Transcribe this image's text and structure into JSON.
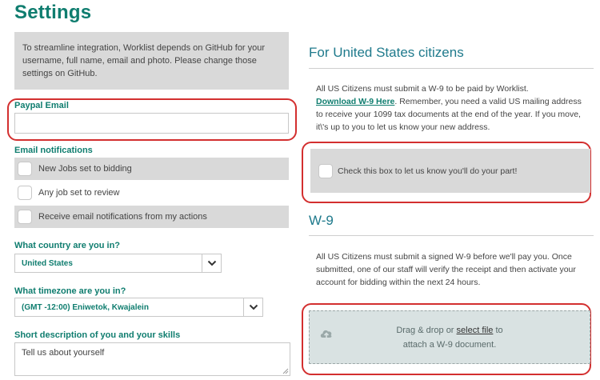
{
  "page": {
    "title": "Settings"
  },
  "info_box": {
    "text": "To streamline integration, Worklist depends on GitHub for your username, full name, email and photo. Please change those settings on GitHub."
  },
  "paypal": {
    "label": "Paypal Email",
    "value": ""
  },
  "email_notifications": {
    "heading": "Email notifications",
    "options": [
      {
        "label": "New Jobs set to bidding",
        "checked": false
      },
      {
        "label": "Any job set to review",
        "checked": false
      },
      {
        "label": "Receive email notifications from my actions",
        "checked": false
      }
    ]
  },
  "country": {
    "label": "What country are you in?",
    "selected": "United States"
  },
  "timezone": {
    "label": "What timezone are you in?",
    "selected": "(GMT -12:00) Eniwetok, Kwajalein"
  },
  "description": {
    "label": "Short description of you and your skills",
    "placeholder": "Tell us about yourself"
  },
  "us_citizens": {
    "title": "For United States citizens",
    "text_before_link": "All US Citizens must submit a W-9 to be paid by Worklist.",
    "link": "Download W-9 Here",
    "text_after_link": ". Remember, you need a valid US mailing address to receive your 1099 tax documents at the end of the year. If you move, it\\'s up to you to let us know your new address.",
    "checkbox_label": "Check this box to let us know you'll do your part!"
  },
  "w9": {
    "title": "W-9",
    "text": "All US Citizens must submit a signed W-9 before we'll pay you. Once submitted, one of our staff will verify the receipt and then activate your account for bidding within the next 24 hours.",
    "dropzone_prefix": "Drag & drop or",
    "dropzone_link": "select file",
    "dropzone_suffix": "to",
    "dropzone_line2": "attach a W-9 document."
  },
  "icons": {
    "chevron": "chevron-down-icon",
    "upload": "upload-cloud-icon",
    "resize": "resize-grip-icon"
  },
  "colors": {
    "accent": "#0f7d6f",
    "section_title": "#1f7a8c",
    "panel": "#d9d9d9",
    "highlight": "#d32f2f"
  }
}
